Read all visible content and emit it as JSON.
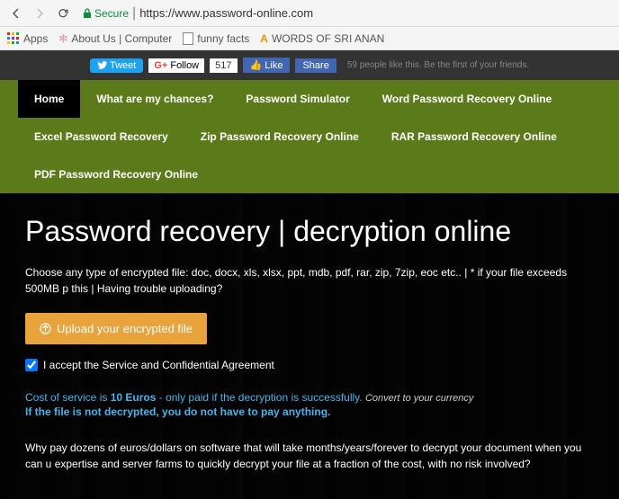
{
  "browser": {
    "secure_label": "Secure",
    "url": "https://www.password-online.com"
  },
  "bookmarks": {
    "apps": "Apps",
    "item1": "About Us | Computer",
    "item2": "funny facts",
    "item3": "WORDS OF SRI ANAN"
  },
  "social": {
    "tweet": "Tweet",
    "follow": "Follow",
    "count": "517",
    "like": "Like",
    "share": "Share",
    "text": "59 people like this. Be the first of your friends."
  },
  "nav": {
    "items": [
      "Home",
      "What are my chances?",
      "Password Simulator",
      "Word Password Recovery Online",
      "Excel Password Recovery",
      "Zip Password Recovery Online",
      "RAR Password Recovery Online",
      "PDF Password Recovery Online"
    ]
  },
  "hero": {
    "title": "Password recovery | decryption online",
    "subtitle": "Choose any type of encrypted file: doc, docx, xls, xlsx, ppt, mdb, pdf, rar, zip, 7zip, eoc etc..   |   * if your file exceeds 500MB p this   |   Having trouble uploading?",
    "upload_btn": "Upload your encrypted file",
    "agreement": "I accept the Service and Confidential Agreement",
    "cost_prefix": "Cost of service is ",
    "cost_amount": "10 Euros",
    "cost_suffix": " - only paid if the decryption is successfully. ",
    "cost_convert": "Convert to your currency",
    "cost_line2": "If the file is not decrypted, you do not have to pay anything.",
    "bottom": "Why pay dozens of euros/dollars on software that will take months/years/forever to decrypt your document when you can u expertise and server farms to quickly decrypt your file at a fraction of the cost, with no risk involved?"
  }
}
